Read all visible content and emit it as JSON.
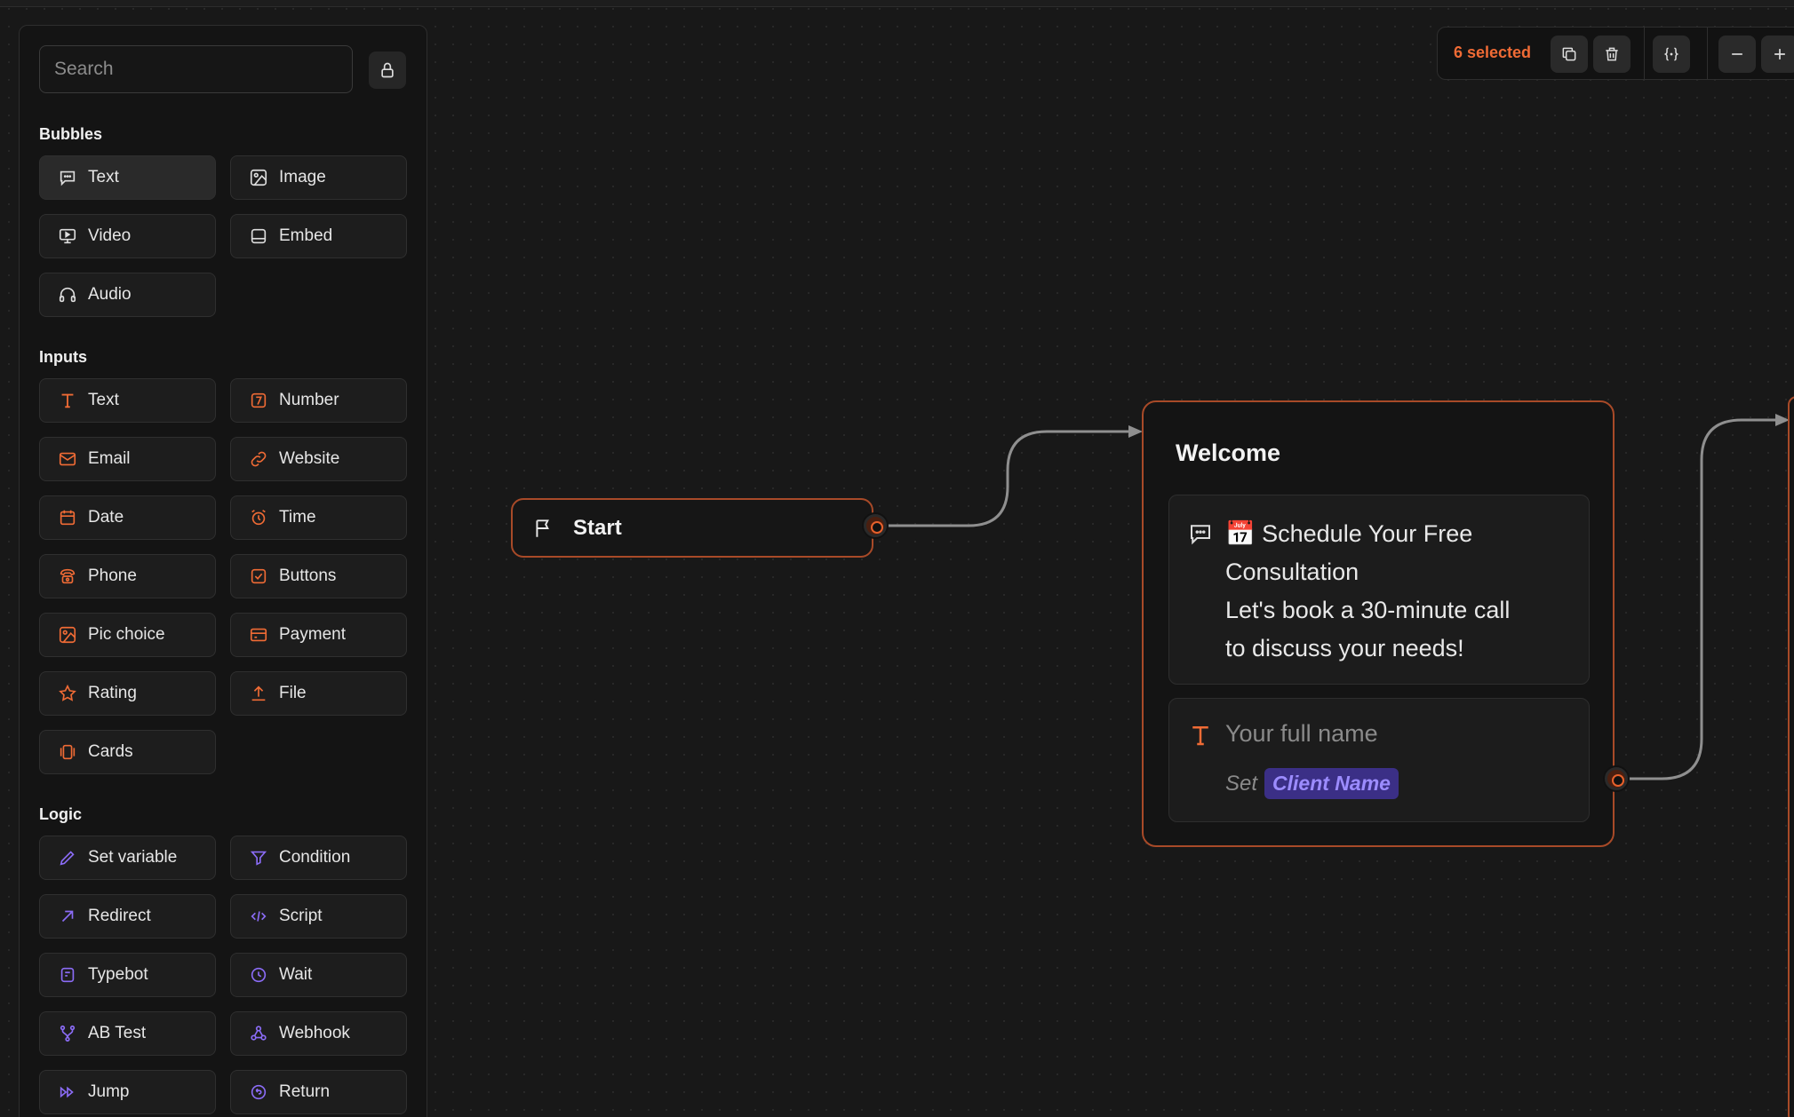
{
  "sidebar": {
    "search_placeholder": "Search",
    "sections": {
      "bubbles": {
        "title": "Bubbles",
        "items": [
          "Text",
          "Image",
          "Video",
          "Embed",
          "Audio"
        ]
      },
      "inputs": {
        "title": "Inputs",
        "items": [
          "Text",
          "Number",
          "Email",
          "Website",
          "Date",
          "Time",
          "Phone",
          "Buttons",
          "Pic choice",
          "Payment",
          "Rating",
          "File",
          "Cards"
        ]
      },
      "logic": {
        "title": "Logic",
        "items": [
          "Set variable",
          "Condition",
          "Redirect",
          "Script",
          "Typebot",
          "Wait",
          "AB Test",
          "Webhook",
          "Jump",
          "Return"
        ]
      }
    }
  },
  "toolbar": {
    "selected_label": "6 selected"
  },
  "canvas": {
    "start_node": {
      "label": "Start"
    },
    "group": {
      "title": "Welcome",
      "message_lines": [
        "📅 Schedule Your Free",
        "Consultation",
        "Let's book a 30-minute call",
        "to discuss your needs!"
      ],
      "input_placeholder": "Your full name",
      "set_label": "Set",
      "variable_name": "Client Name"
    }
  },
  "colors": {
    "accent_orange": "#f06b35",
    "logic_purple": "#8b6cf6",
    "variable_bg": "#3b2f86",
    "node_border": "#a84a28"
  }
}
